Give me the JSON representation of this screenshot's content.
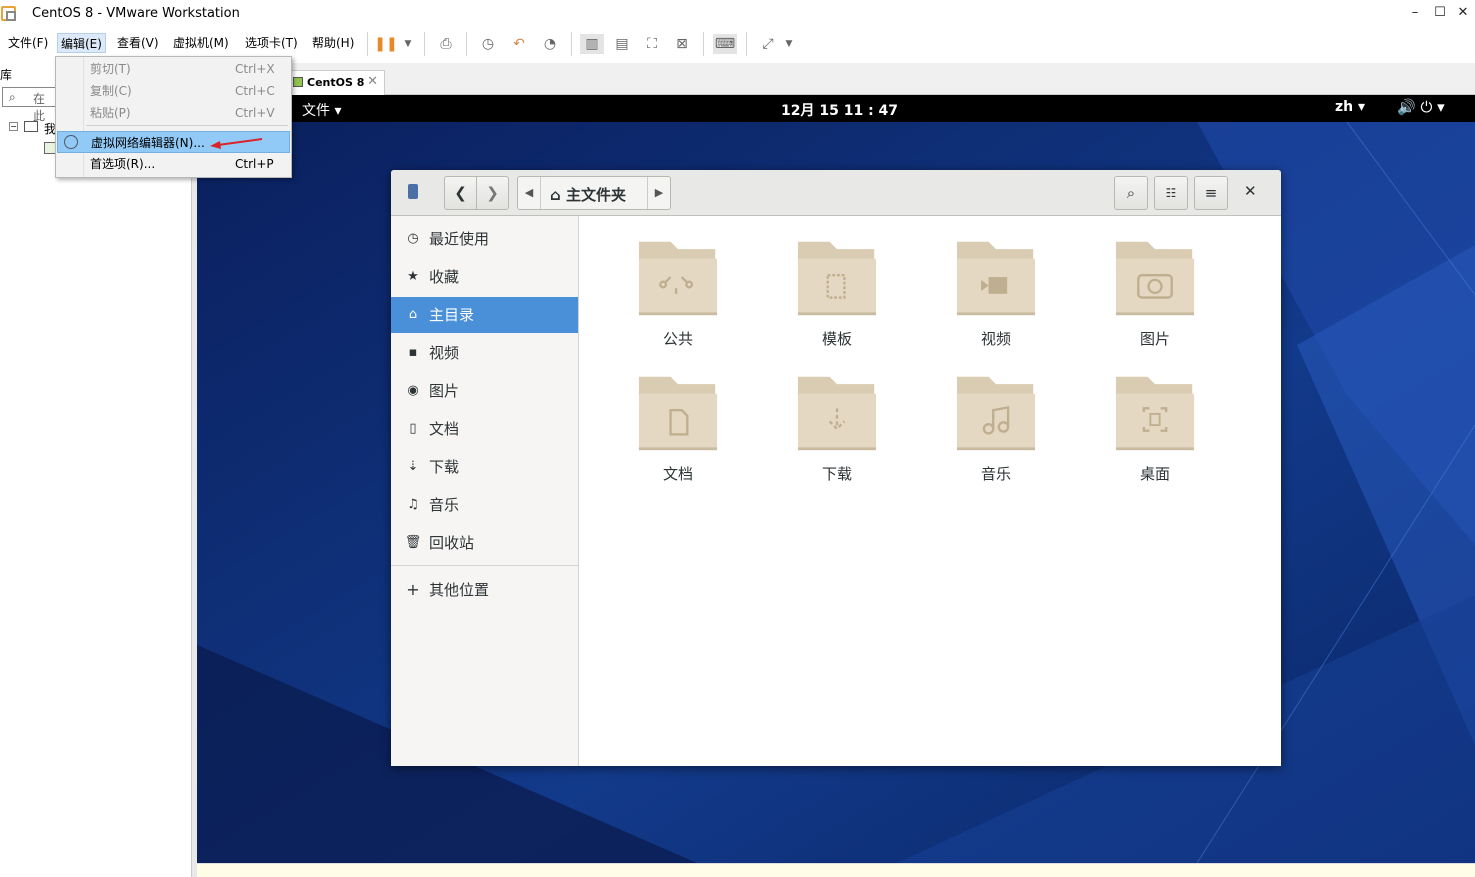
{
  "window": {
    "title": "CentOS 8 - VMware Workstation",
    "min": "–",
    "max": "☐",
    "close": "✕"
  },
  "menubar": [
    "文件(F)",
    "编辑(E)",
    "查看(V)",
    "虚拟机(M)",
    "选项卡(T)",
    "帮助(H)"
  ],
  "library": {
    "header": "库",
    "search_placeholder": "在此",
    "tree_root": "我"
  },
  "tab": {
    "label": "CentOS 8",
    "close": "✕"
  },
  "edit_menu": {
    "items": [
      {
        "label": "剪切(T)",
        "shortcut": "Ctrl+X",
        "enabled": false
      },
      {
        "label": "复制(C)",
        "shortcut": "Ctrl+C",
        "enabled": false
      },
      {
        "label": "粘贴(P)",
        "shortcut": "Ctrl+V",
        "enabled": false
      },
      {
        "label": "虚拟网络编辑器(N)...",
        "shortcut": "",
        "enabled": true,
        "highlighted": true
      },
      {
        "label": "首选项(R)...",
        "shortcut": "Ctrl+P",
        "enabled": true
      }
    ]
  },
  "guest": {
    "activities": "文件 ▾",
    "clock": "12月 15  11 : 47",
    "lang": "zh ▾",
    "system": "🔊  ⏻ ▾"
  },
  "file_manager": {
    "path": "主文件夹",
    "sidebar": [
      {
        "icon": "clock-icon",
        "glyph": "◷",
        "label": "最近使用"
      },
      {
        "icon": "star-icon",
        "glyph": "★",
        "label": "收藏"
      },
      {
        "icon": "home-icon",
        "glyph": "⌂",
        "label": "主目录",
        "selected": true
      },
      {
        "icon": "video-icon",
        "glyph": "▪",
        "label": "视频"
      },
      {
        "icon": "camera-icon",
        "glyph": "◉",
        "label": "图片"
      },
      {
        "icon": "document-icon",
        "glyph": "▯",
        "label": "文档"
      },
      {
        "icon": "download-icon",
        "glyph": "⇣",
        "label": "下载"
      },
      {
        "icon": "music-icon",
        "glyph": "♫",
        "label": "音乐"
      },
      {
        "icon": "trash-icon",
        "glyph": "🗑",
        "label": "回收站"
      },
      {
        "icon": "plus-icon",
        "glyph": "+",
        "label": "其他位置"
      }
    ],
    "folders": [
      {
        "label": "公共",
        "icon": "share-icon"
      },
      {
        "label": "模板",
        "icon": "template-icon"
      },
      {
        "label": "视频",
        "icon": "video-icon"
      },
      {
        "label": "图片",
        "icon": "camera-icon"
      },
      {
        "label": "文档",
        "icon": "document-icon"
      },
      {
        "label": "下载",
        "icon": "download-icon"
      },
      {
        "label": "音乐",
        "icon": "music-icon"
      },
      {
        "label": "桌面",
        "icon": "desktop-icon"
      }
    ]
  },
  "colors": {
    "selection": "#4a90d9",
    "folder": "#e4d8c2",
    "desktop": "#0e2a6b",
    "menu_highlight": "#91c9f7"
  }
}
